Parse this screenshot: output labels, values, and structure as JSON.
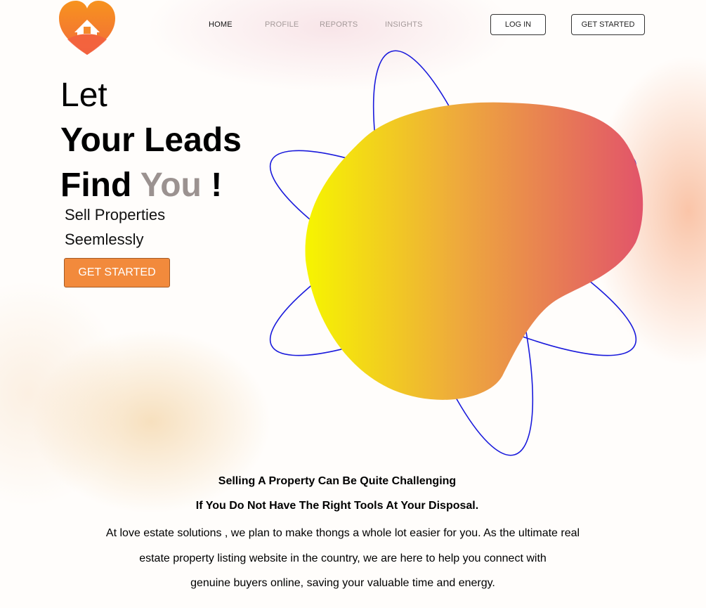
{
  "brand": {
    "logo_icon": "heart-house-icon",
    "colors": {
      "orange": "#f28a3c",
      "red": "#ef5a4a",
      "yellow": "#f6f200",
      "orbit": "#1a1adc"
    }
  },
  "nav": {
    "home": "HOME",
    "profile": "PROFILE",
    "reports": "REPORTS",
    "insights": "INSIGHTS",
    "login": "LOG IN",
    "get_started": "GET STARTED"
  },
  "hero": {
    "line1": "Let",
    "line2": "Your Leads",
    "line3_a": "Find",
    "line3_b": "You",
    "line3_c": "!",
    "sub1": "Sell Properties",
    "sub2": "Seemlessly",
    "cta": "GET STARTED"
  },
  "about": {
    "heading1": "Selling A Property Can Be Quite Challenging",
    "heading2": "If You Do Not Have The Right Tools At Your Disposal.",
    "line1": "At love estate solutions , we plan to make thongs a whole lot easier for you. As the ultimate  real",
    "line2": "estate property listing website in the country, we are here to help you connect with",
    "line3": "genuine buyers online, saving your valuable time and energy."
  }
}
